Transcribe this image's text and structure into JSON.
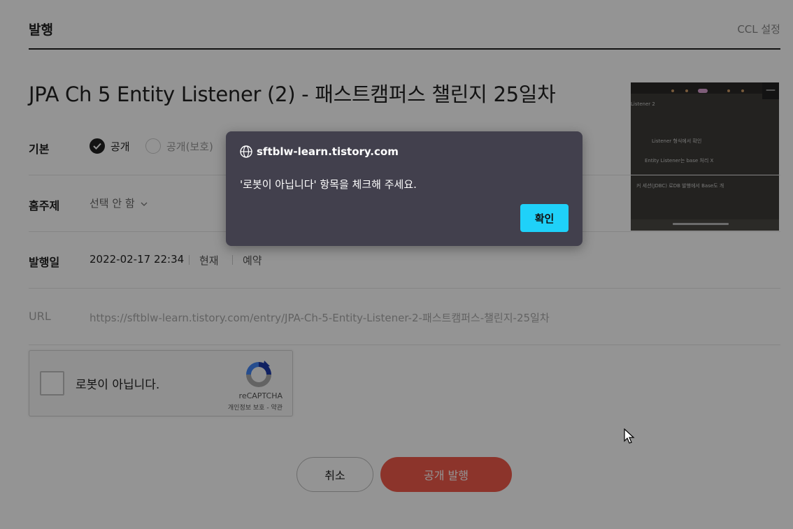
{
  "header": {
    "title": "발행",
    "ccl_label": "CCL 설정"
  },
  "post": {
    "title": "JPA Ch 5 Entity Listener (2) - 패스트캠퍼스 챌린지 25일차"
  },
  "rows": {
    "visibility": {
      "label": "기본",
      "options": [
        {
          "label": "공개",
          "checked": true
        },
        {
          "label": "공개(보호)",
          "checked": false
        }
      ]
    },
    "topic": {
      "label": "홈주제",
      "value": "선택 안 함"
    },
    "publish_date": {
      "label": "발행일",
      "value": "2022-02-17 22:34",
      "now_label": "현재",
      "reserve_label": "예약"
    },
    "url": {
      "label": "URL",
      "value": "https://sftblw-learn.tistory.com/entry/JPA-Ch-5-Entity-Listener-2-패스트캠퍼스-챌린지-25일차"
    }
  },
  "recaptcha": {
    "label": "로봇이 아닙니다.",
    "brand": "reCAPTCHA",
    "privacy": "개인정보 보호",
    "terms": "약관",
    "separator": "-"
  },
  "buttons": {
    "cancel": "취소",
    "publish": "공개 발행"
  },
  "thumbnail": {
    "delete_symbol": "—",
    "text_lines": [
      "Listener 2",
      "Entity Listener는  base 처리  X",
      "Listener  형식에서  확인",
      "커  세션(JDBC)  로DB  발행에서  Base도 개"
    ]
  },
  "dialog": {
    "origin": "sftblw-learn.tistory.com",
    "message": "'로봇이 아닙니다' 항목을 체크해 주세요.",
    "ok_label": "확인"
  },
  "colors": {
    "publish_button": "#f15b4b",
    "dialog_bg": "#42404d",
    "dialog_ok": "#1fd1f9"
  }
}
